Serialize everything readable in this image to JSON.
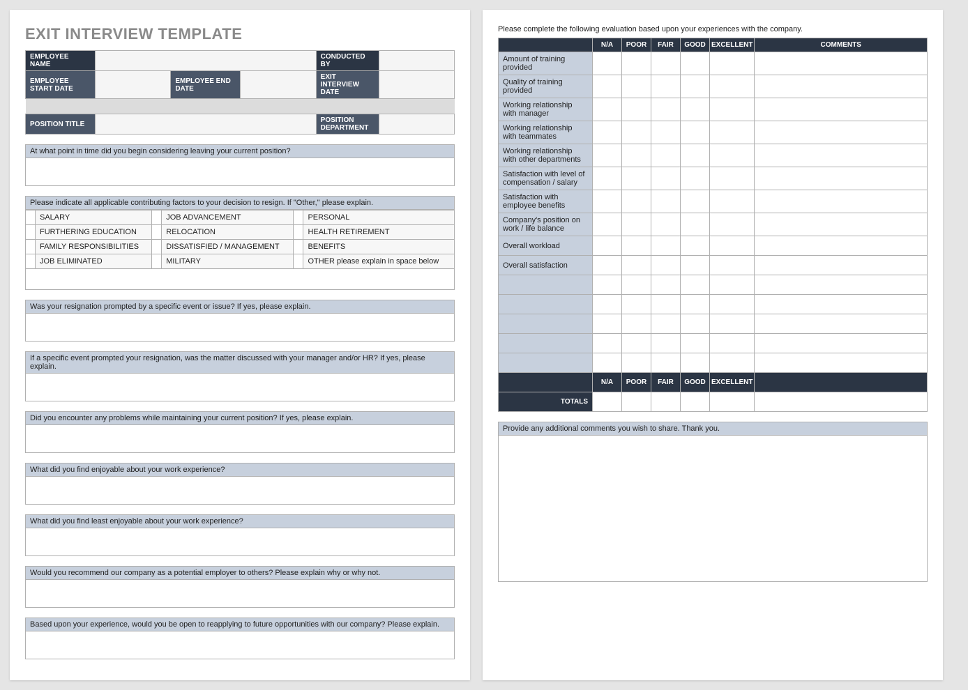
{
  "title": "EXIT INTERVIEW TEMPLATE",
  "header": {
    "employee_name": "EMPLOYEE NAME",
    "conducted_by": "CONDUCTED BY",
    "employee_start_date": "EMPLOYEE START DATE",
    "employee_end_date": "EMPLOYEE END DATE",
    "exit_interview_date": "EXIT INTERVIEW DATE",
    "position_title": "POSITION TITLE",
    "position_department": "POSITION DEPARTMENT"
  },
  "questions": {
    "q1": "At what point in time did you begin considering leaving your current position?",
    "q2": "Please indicate all applicable contributing factors to your decision to resign. If \"Other,\" please explain.",
    "q3": "Was your resignation prompted by a specific event or issue? If yes, please explain.",
    "q4": "If a specific event prompted your resignation, was the matter discussed with your manager and/or HR? If yes, please explain.",
    "q5": "Did you encounter any problems while maintaining your current position?  If yes, please explain.",
    "q6": "What did you find enjoyable about your work experience?",
    "q7": "What did you find least enjoyable about your work experience?",
    "q8": "Would you recommend our company as a potential employer to others? Please explain why or why not.",
    "q9": "Based upon your experience, would you be open to reapplying to future opportunities with our company?  Please explain."
  },
  "factors": {
    "r1c1": "SALARY",
    "r1c2": "JOB ADVANCEMENT",
    "r1c3": "PERSONAL",
    "r2c1": "FURTHERING EDUCATION",
    "r2c2": "RELOCATION",
    "r2c3": "HEALTH RETIREMENT",
    "r3c1": "FAMILY RESPONSIBILITIES",
    "r3c2": "DISSATISFIED / MANAGEMENT",
    "r3c3": "BENEFITS",
    "r4c1": "JOB ELIMINATED",
    "r4c2": "MILITARY",
    "r4c3": "OTHER please explain in space below"
  },
  "eval": {
    "instruction": "Please complete the following evaluation based upon your experiences with the company.",
    "cols": {
      "na": "N/A",
      "poor": "POOR",
      "fair": "FAIR",
      "good": "GOOD",
      "excellent": "EXCELLENT",
      "comments": "COMMENTS"
    },
    "rows": [
      "Amount of training provided",
      "Quality of training provided",
      "Working relationship with manager",
      "Working relationship with teammates",
      "Working relationship with other departments",
      "Satisfaction with level of compensation / salary",
      "Satisfaction with employee benefits",
      "Company's position on work / life balance",
      "Overall workload",
      "Overall satisfaction"
    ],
    "totals": "TOTALS"
  },
  "additional": "Provide any additional comments you wish to share.  Thank you."
}
